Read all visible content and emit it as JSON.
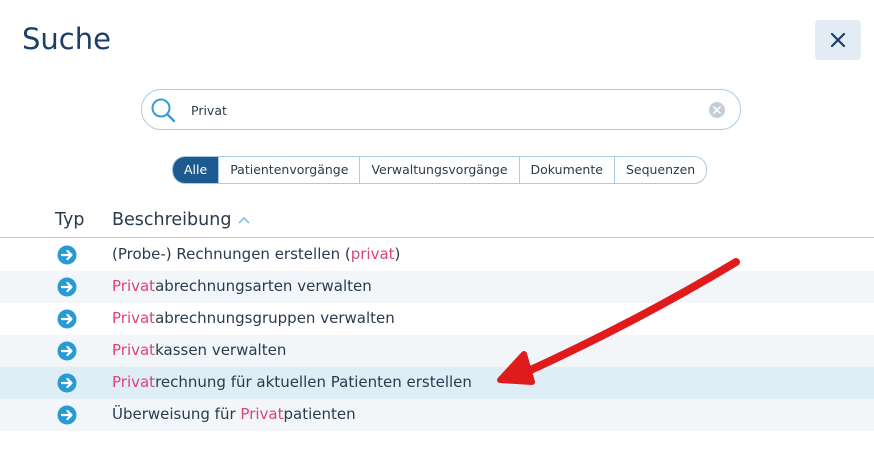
{
  "dialog": {
    "title": "Suche",
    "close_icon": "close-icon"
  },
  "search": {
    "value": "Privat",
    "placeholder": "",
    "icon": "search-icon",
    "clear_icon": "clear-icon"
  },
  "filters": [
    {
      "label": "Alle",
      "active": true
    },
    {
      "label": "Patientenvorgänge",
      "active": false
    },
    {
      "label": "Verwaltungsvorgänge",
      "active": false
    },
    {
      "label": "Dokumente",
      "active": false
    },
    {
      "label": "Sequenzen",
      "active": false
    }
  ],
  "table": {
    "columns": [
      "Typ",
      "Beschreibung"
    ],
    "sort_icon": "sort-ascending-icon",
    "rows": [
      {
        "icon": "arrow-right-circle-icon",
        "before": "(Probe-) Rechnungen erstellen (",
        "match": "privat",
        "after": ")"
      },
      {
        "icon": "arrow-right-circle-icon",
        "before": "",
        "match": "Privat",
        "after": "abrechnungsarten verwalten"
      },
      {
        "icon": "arrow-right-circle-icon",
        "before": "",
        "match": "Privat",
        "after": "abrechnungsgruppen verwalten"
      },
      {
        "icon": "arrow-right-circle-icon",
        "before": "",
        "match": "Privat",
        "after": "kassen verwalten"
      },
      {
        "icon": "arrow-right-circle-icon",
        "before": "",
        "match": "Privat",
        "after": "rechnung für aktuellen Patienten erstellen"
      },
      {
        "icon": "arrow-right-circle-icon",
        "before": "Überweisung für ",
        "match": "Privat",
        "after": "patienten"
      }
    ]
  },
  "colors": {
    "accent": "#1d5a8f",
    "match": "#d9457a",
    "icon": "#2a9ad4",
    "annotation_arrow": "#e01b1b"
  },
  "annotation": {
    "icon": "red-annotation-arrow"
  }
}
